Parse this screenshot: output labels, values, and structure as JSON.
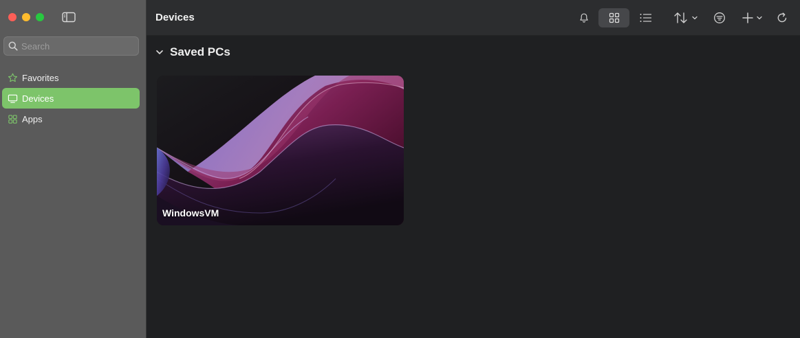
{
  "sidebar": {
    "search_placeholder": "Search",
    "items": [
      {
        "label": "Favorites",
        "icon": "star-icon",
        "active": false
      },
      {
        "label": "Devices",
        "icon": "monitor-icon",
        "active": true
      },
      {
        "label": "Apps",
        "icon": "apps-icon",
        "active": false
      }
    ]
  },
  "toolbar": {
    "title": "Devices",
    "buttons": [
      "bell-icon",
      "grid-view-icon",
      "list-view-icon",
      "sort-icon",
      "filter-icon",
      "add-icon",
      "refresh-icon"
    ],
    "selected_view": "grid"
  },
  "main": {
    "section_title": "Saved PCs",
    "pcs": [
      {
        "name": "WindowsVM"
      }
    ]
  },
  "colors": {
    "accent": "#7dc46a",
    "sidebar_bg": "#5a5a5a",
    "main_bg": "#1f2022",
    "toolbar_bg": "#2c2d2f"
  }
}
